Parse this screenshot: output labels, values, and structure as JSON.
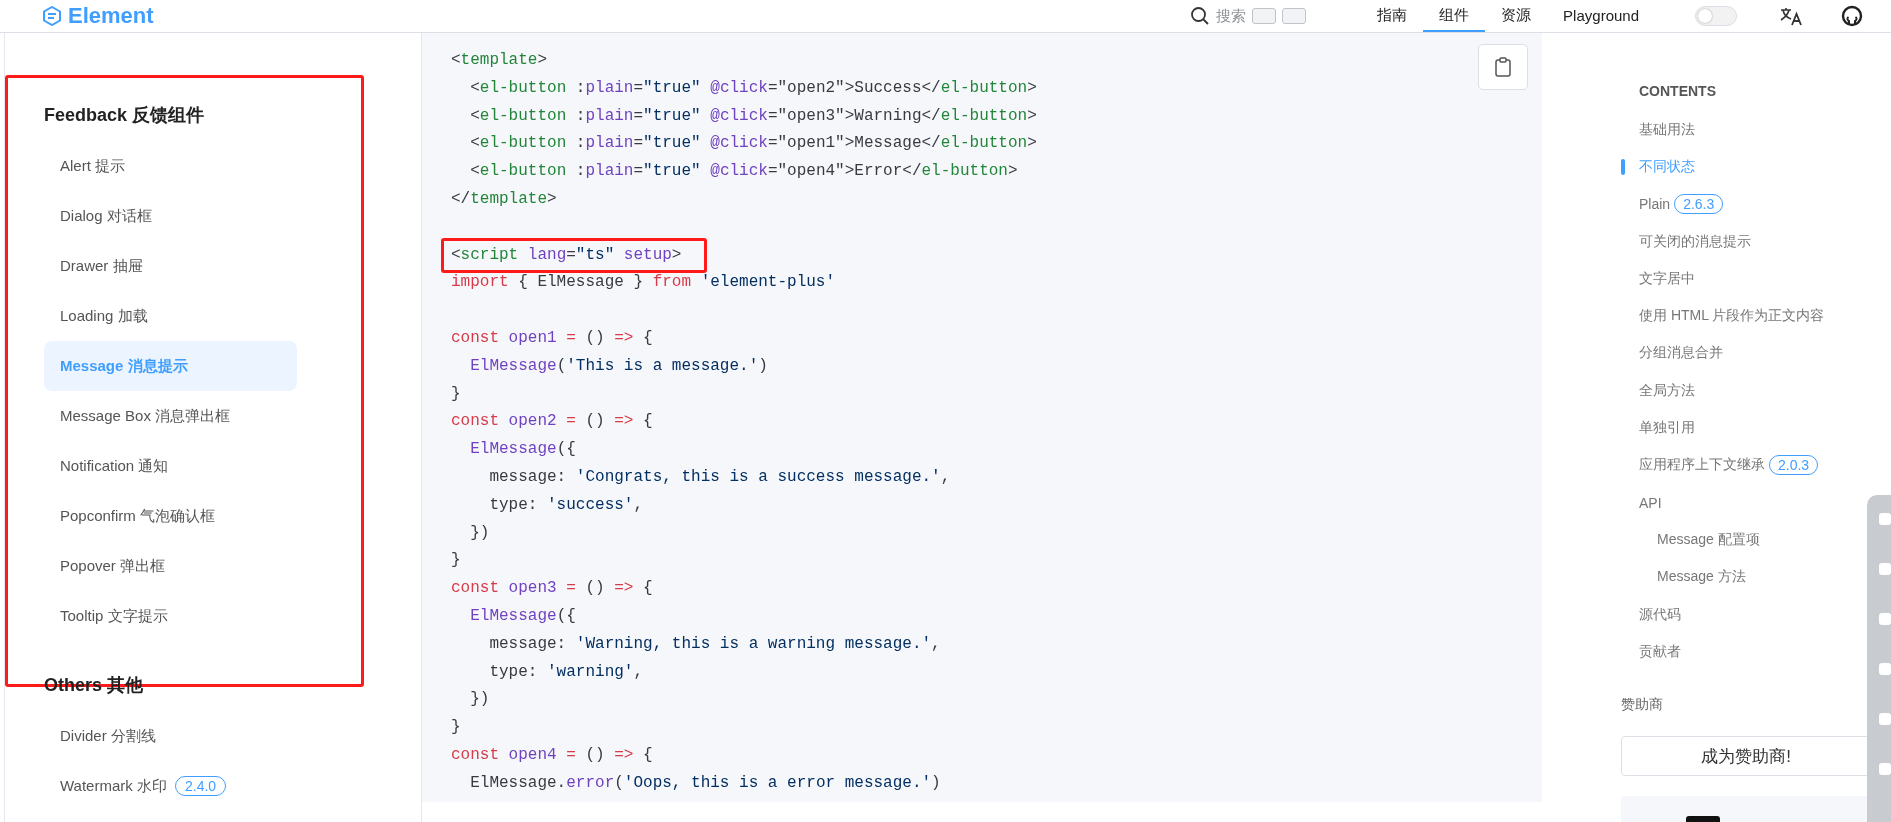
{
  "header": {
    "logo": "Element",
    "search": {
      "placeholder": "搜索"
    },
    "nav": [
      {
        "label": "指南",
        "selected": false
      },
      {
        "label": "组件",
        "selected": true
      },
      {
        "label": "资源",
        "selected": false
      },
      {
        "label": "Playground",
        "selected": false
      }
    ],
    "theme_toggle": {
      "on": false
    }
  },
  "sidebar": {
    "groups": [
      {
        "title": "Feedback 反馈组件",
        "highlighted": true,
        "items": [
          {
            "label": "Alert 提示",
            "selected": false
          },
          {
            "label": "Dialog 对话框",
            "selected": false
          },
          {
            "label": "Drawer 抽屉",
            "selected": false
          },
          {
            "label": "Loading 加载",
            "selected": false
          },
          {
            "label": "Message 消息提示",
            "selected": true
          },
          {
            "label": "Message Box 消息弹出框",
            "selected": false
          },
          {
            "label": "Notification 通知",
            "selected": false
          },
          {
            "label": "Popconfirm 气泡确认框",
            "selected": false
          },
          {
            "label": "Popover 弹出框",
            "selected": false
          },
          {
            "label": "Tooltip 文字提示",
            "selected": false
          }
        ]
      },
      {
        "title": "Others 其他",
        "highlighted": false,
        "items": [
          {
            "label": "Divider 分割线",
            "selected": false
          },
          {
            "label": "Watermark 水印",
            "badge": "2.4.0",
            "selected": false
          }
        ]
      }
    ]
  },
  "code": {
    "lines": [
      {
        "kind": "code",
        "highlighted": false,
        "tokens": [
          {
            "kind": "punct",
            "text": "<"
          },
          {
            "kind": "tag",
            "text": "template"
          },
          {
            "kind": "punct",
            "text": ">"
          }
        ]
      },
      {
        "kind": "code",
        "highlighted": false,
        "tokens": [
          {
            "kind": "punct",
            "text": "  <"
          },
          {
            "kind": "tag",
            "text": "el-button"
          },
          {
            "kind": "punct",
            "text": " :"
          },
          {
            "kind": "attr",
            "text": "plain"
          },
          {
            "kind": "punct",
            "text": "="
          },
          {
            "kind": "string",
            "text": "\"true\""
          },
          {
            "kind": "attr",
            "text": " @click"
          },
          {
            "kind": "punct",
            "text": "=\"open2\">Success</"
          },
          {
            "kind": "tag",
            "text": "el-button"
          },
          {
            "kind": "punct",
            "text": ">"
          }
        ]
      },
      {
        "kind": "code",
        "highlighted": false,
        "tokens": [
          {
            "kind": "punct",
            "text": "  <"
          },
          {
            "kind": "tag",
            "text": "el-button"
          },
          {
            "kind": "punct",
            "text": " :"
          },
          {
            "kind": "attr",
            "text": "plain"
          },
          {
            "kind": "punct",
            "text": "="
          },
          {
            "kind": "string",
            "text": "\"true\""
          },
          {
            "kind": "attr",
            "text": " @click"
          },
          {
            "kind": "punct",
            "text": "=\"open3\">Warning</"
          },
          {
            "kind": "tag",
            "text": "el-button"
          },
          {
            "kind": "punct",
            "text": ">"
          }
        ]
      },
      {
        "kind": "code",
        "highlighted": false,
        "tokens": [
          {
            "kind": "punct",
            "text": "  <"
          },
          {
            "kind": "tag",
            "text": "el-button"
          },
          {
            "kind": "punct",
            "text": " :"
          },
          {
            "kind": "attr",
            "text": "plain"
          },
          {
            "kind": "punct",
            "text": "="
          },
          {
            "kind": "string",
            "text": "\"true\""
          },
          {
            "kind": "attr",
            "text": " @click"
          },
          {
            "kind": "punct",
            "text": "=\"open1\">Message</"
          },
          {
            "kind": "tag",
            "text": "el-button"
          },
          {
            "kind": "punct",
            "text": ">"
          }
        ]
      },
      {
        "kind": "code",
        "highlighted": false,
        "tokens": [
          {
            "kind": "punct",
            "text": "  <"
          },
          {
            "kind": "tag",
            "text": "el-button"
          },
          {
            "kind": "punct",
            "text": " :"
          },
          {
            "kind": "attr",
            "text": "plain"
          },
          {
            "kind": "punct",
            "text": "="
          },
          {
            "kind": "string",
            "text": "\"true\""
          },
          {
            "kind": "attr",
            "text": " @click"
          },
          {
            "kind": "punct",
            "text": "=\"open4\">Error</"
          },
          {
            "kind": "tag",
            "text": "el-button"
          },
          {
            "kind": "punct",
            "text": ">"
          }
        ]
      },
      {
        "kind": "code",
        "highlighted": false,
        "tokens": [
          {
            "kind": "punct",
            "text": "</"
          },
          {
            "kind": "tag",
            "text": "template"
          },
          {
            "kind": "punct",
            "text": ">"
          }
        ]
      },
      {
        "kind": "blank"
      },
      {
        "kind": "code",
        "highlighted": true,
        "tokens": [
          {
            "kind": "punct",
            "text": "<"
          },
          {
            "kind": "tag",
            "text": "script"
          },
          {
            "kind": "attr",
            "text": " lang"
          },
          {
            "kind": "punct",
            "text": "="
          },
          {
            "kind": "string",
            "text": "\"ts\""
          },
          {
            "kind": "attr",
            "text": " setup"
          },
          {
            "kind": "punct",
            "text": ">"
          }
        ]
      },
      {
        "kind": "code",
        "highlighted": false,
        "tokens": [
          {
            "kind": "keyword",
            "text": "import"
          },
          {
            "kind": "punct",
            "text": " { ElMessage } "
          },
          {
            "kind": "keyword",
            "text": "from"
          },
          {
            "kind": "string",
            "text": " 'element-plus'"
          }
        ]
      },
      {
        "kind": "blank"
      },
      {
        "kind": "code",
        "highlighted": false,
        "tokens": [
          {
            "kind": "keyword",
            "text": "const"
          },
          {
            "kind": "attr",
            "text": " open1"
          },
          {
            "kind": "keyword",
            "text": " ="
          },
          {
            "kind": "punct",
            "text": " () "
          },
          {
            "kind": "keyword",
            "text": "=>"
          },
          {
            "kind": "punct",
            "text": " {"
          }
        ]
      },
      {
        "kind": "code",
        "highlighted": false,
        "tokens": [
          {
            "kind": "attr",
            "text": "  ElMessage"
          },
          {
            "kind": "punct",
            "text": "("
          },
          {
            "kind": "string",
            "text": "'This is a message.'"
          },
          {
            "kind": "punct",
            "text": ")"
          }
        ]
      },
      {
        "kind": "code",
        "highlighted": false,
        "tokens": [
          {
            "kind": "punct",
            "text": "}"
          }
        ]
      },
      {
        "kind": "code",
        "highlighted": false,
        "tokens": [
          {
            "kind": "keyword",
            "text": "const"
          },
          {
            "kind": "attr",
            "text": " open2"
          },
          {
            "kind": "keyword",
            "text": " ="
          },
          {
            "kind": "punct",
            "text": " () "
          },
          {
            "kind": "keyword",
            "text": "=>"
          },
          {
            "kind": "punct",
            "text": " {"
          }
        ]
      },
      {
        "kind": "code",
        "highlighted": false,
        "tokens": [
          {
            "kind": "attr",
            "text": "  ElMessage"
          },
          {
            "kind": "punct",
            "text": "({"
          }
        ]
      },
      {
        "kind": "code",
        "highlighted": false,
        "tokens": [
          {
            "kind": "punct",
            "text": "    message: "
          },
          {
            "kind": "string",
            "text": "'Congrats, this is a success message.'"
          },
          {
            "kind": "punct",
            "text": ","
          }
        ]
      },
      {
        "kind": "code",
        "highlighted": false,
        "tokens": [
          {
            "kind": "punct",
            "text": "    type: "
          },
          {
            "kind": "string",
            "text": "'success'"
          },
          {
            "kind": "punct",
            "text": ","
          }
        ]
      },
      {
        "kind": "code",
        "highlighted": false,
        "tokens": [
          {
            "kind": "punct",
            "text": "  })"
          }
        ]
      },
      {
        "kind": "code",
        "highlighted": false,
        "tokens": [
          {
            "kind": "punct",
            "text": "}"
          }
        ]
      },
      {
        "kind": "code",
        "highlighted": false,
        "tokens": [
          {
            "kind": "keyword",
            "text": "const"
          },
          {
            "kind": "attr",
            "text": " open3"
          },
          {
            "kind": "keyword",
            "text": " ="
          },
          {
            "kind": "punct",
            "text": " () "
          },
          {
            "kind": "keyword",
            "text": "=>"
          },
          {
            "kind": "punct",
            "text": " {"
          }
        ]
      },
      {
        "kind": "code",
        "highlighted": false,
        "tokens": [
          {
            "kind": "attr",
            "text": "  ElMessage"
          },
          {
            "kind": "punct",
            "text": "({"
          }
        ]
      },
      {
        "kind": "code",
        "highlighted": false,
        "tokens": [
          {
            "kind": "punct",
            "text": "    message: "
          },
          {
            "kind": "string",
            "text": "'Warning, this is a warning message.'"
          },
          {
            "kind": "punct",
            "text": ","
          }
        ]
      },
      {
        "kind": "code",
        "highlighted": false,
        "tokens": [
          {
            "kind": "punct",
            "text": "    type: "
          },
          {
            "kind": "string",
            "text": "'warning'"
          },
          {
            "kind": "punct",
            "text": ","
          }
        ]
      },
      {
        "kind": "code",
        "highlighted": false,
        "tokens": [
          {
            "kind": "punct",
            "text": "  })"
          }
        ]
      },
      {
        "kind": "code",
        "highlighted": false,
        "tokens": [
          {
            "kind": "punct",
            "text": "}"
          }
        ]
      },
      {
        "kind": "code",
        "highlighted": false,
        "tokens": [
          {
            "kind": "keyword",
            "text": "const"
          },
          {
            "kind": "attr",
            "text": " open4"
          },
          {
            "kind": "keyword",
            "text": " ="
          },
          {
            "kind": "punct",
            "text": " () "
          },
          {
            "kind": "keyword",
            "text": "=>"
          },
          {
            "kind": "punct",
            "text": " {"
          }
        ]
      },
      {
        "kind": "code",
        "highlighted": false,
        "tokens": [
          {
            "kind": "punct",
            "text": "  ElMessage."
          },
          {
            "kind": "attr",
            "text": "error"
          },
          {
            "kind": "punct",
            "text": "("
          },
          {
            "kind": "string",
            "text": "'Oops, this is a error message.'"
          },
          {
            "kind": "punct",
            "text": ")"
          }
        ]
      }
    ]
  },
  "toc": {
    "title": "CONTENTS",
    "items": [
      {
        "label": "基础用法",
        "selected": false
      },
      {
        "label": "不同状态",
        "selected": true
      },
      {
        "label": "Plain",
        "badge": "2.6.3",
        "selected": false
      },
      {
        "label": "可关闭的消息提示",
        "selected": false
      },
      {
        "label": "文字居中",
        "selected": false
      },
      {
        "label": "使用 HTML 片段作为正文内容",
        "selected": false
      },
      {
        "label": "分组消息合并",
        "selected": false
      },
      {
        "label": "全局方法",
        "selected": false
      },
      {
        "label": "单独引用",
        "selected": false
      },
      {
        "label": "应用程序上下文继承",
        "badge": "2.0.3",
        "selected": false
      },
      {
        "label": "API",
        "selected": false,
        "children": [
          {
            "label": "Message 配置项",
            "selected": false
          },
          {
            "label": "Message 方法",
            "selected": false
          }
        ]
      },
      {
        "label": "源代码",
        "selected": false
      },
      {
        "label": "贡献者",
        "selected": false
      }
    ],
    "sponsor_title": "赞助商",
    "sponsor_button": "成为赞助商!"
  }
}
